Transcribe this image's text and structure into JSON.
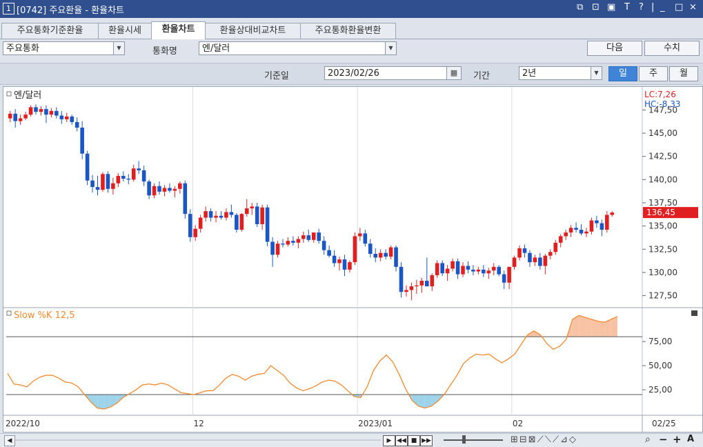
{
  "window": {
    "num": "1",
    "title": "[0742] 주요환율 - 환율차트",
    "controls": [
      "⧉",
      "⊡",
      "▣",
      "T",
      "?",
      "|",
      "_",
      "□",
      "×"
    ]
  },
  "tabs": [
    "주요통화기준환율",
    "환율시세",
    "환율차트",
    "환율상대비교차트",
    "주요통화환율변환"
  ],
  "filter": {
    "category": "주요통화",
    "currency_label": "통화명",
    "currency": "엔/달러",
    "next_label": "다음",
    "values_label": "수치"
  },
  "filter2": {
    "base_date_label": "기준일",
    "base_date": "2023/02/26",
    "period_label": "기간",
    "period": "2년",
    "periods": [
      "일",
      "주",
      "월"
    ]
  },
  "chart_data": [
    {
      "type": "candlestick",
      "title": "엔/달러",
      "lc": "LC:7,26",
      "hc": "HC:-8,33",
      "current_price": "136,45",
      "ylim": [
        126.5,
        148.5
      ],
      "yticks": [
        "147,50",
        "145,00",
        "142,50",
        "140,00",
        "137,50",
        "135,00",
        "132,50",
        "130,00",
        "127,50"
      ],
      "ytick_values": [
        147.5,
        145,
        142.5,
        140,
        137.5,
        135,
        132.5,
        130,
        127.5
      ],
      "colors": {
        "up": "#e02020",
        "down": "#1a56c4"
      },
      "candles": [
        [
          146.6,
          147.4,
          146.2,
          147.1
        ],
        [
          147.1,
          147.6,
          145.6,
          146.3
        ],
        [
          146.3,
          147.0,
          145.9,
          146.6
        ],
        [
          146.6,
          147.3,
          146.4,
          147.0
        ],
        [
          147.0,
          148.0,
          146.8,
          147.8
        ],
        [
          147.8,
          148.1,
          147.0,
          147.3
        ],
        [
          147.3,
          147.9,
          146.9,
          147.6
        ],
        [
          147.6,
          148.0,
          146.1,
          147.0
        ],
        [
          147.0,
          147.7,
          146.7,
          147.4
        ],
        [
          147.4,
          147.8,
          146.6,
          146.9
        ],
        [
          146.9,
          147.4,
          146.0,
          146.5
        ],
        [
          146.5,
          147.2,
          146.2,
          146.8
        ],
        [
          146.8,
          147.0,
          145.9,
          146.2
        ],
        [
          146.2,
          146.7,
          145.2,
          145.6
        ],
        [
          145.6,
          146.3,
          142.2,
          142.8
        ],
        [
          142.8,
          143.1,
          139.4,
          139.9
        ],
        [
          139.9,
          140.5,
          138.6,
          139.2
        ],
        [
          139.2,
          140.4,
          138.3,
          138.9
        ],
        [
          138.9,
          140.8,
          138.7,
          140.6
        ],
        [
          140.6,
          140.9,
          138.6,
          139.0
        ],
        [
          139.0,
          140.2,
          138.4,
          139.6
        ],
        [
          139.6,
          140.7,
          139.2,
          140.4
        ],
        [
          140.4,
          140.9,
          139.8,
          140.1
        ],
        [
          140.1,
          140.6,
          139.5,
          140.0
        ],
        [
          140.0,
          141.6,
          139.8,
          141.2
        ],
        [
          141.2,
          142.0,
          140.6,
          141.0
        ],
        [
          141.0,
          141.5,
          139.3,
          139.8
        ],
        [
          139.8,
          140.0,
          137.9,
          138.3
        ],
        [
          138.3,
          139.6,
          138.0,
          139.3
        ],
        [
          139.3,
          139.8,
          138.4,
          138.7
        ],
        [
          138.7,
          139.4,
          138.2,
          139.1
        ],
        [
          139.1,
          139.6,
          138.6,
          138.8
        ],
        [
          138.8,
          139.3,
          138.1,
          139.0
        ],
        [
          139.0,
          139.8,
          138.5,
          139.6
        ],
        [
          139.6,
          139.9,
          135.8,
          136.3
        ],
        [
          136.3,
          136.8,
          133.3,
          133.8
        ],
        [
          133.8,
          135.1,
          133.4,
          134.7
        ],
        [
          134.7,
          136.2,
          134.3,
          135.9
        ],
        [
          135.9,
          137.1,
          135.5,
          136.6
        ],
        [
          136.6,
          136.9,
          135.5,
          135.9
        ],
        [
          135.9,
          136.6,
          135.4,
          136.1
        ],
        [
          136.1,
          136.6,
          135.7,
          135.9
        ],
        [
          135.9,
          136.9,
          135.6,
          136.5
        ],
        [
          136.5,
          137.3,
          135.9,
          136.2
        ],
        [
          136.2,
          136.4,
          134.3,
          134.6
        ],
        [
          134.6,
          136.4,
          134.4,
          136.3
        ],
        [
          136.3,
          137.9,
          136.0,
          136.9
        ],
        [
          136.9,
          137.5,
          136.2,
          137.1
        ],
        [
          137.1,
          137.5,
          134.9,
          135.2
        ],
        [
          135.2,
          137.3,
          134.6,
          137.0
        ],
        [
          137.0,
          137.3,
          132.8,
          133.3
        ],
        [
          133.3,
          133.8,
          130.6,
          131.9
        ],
        [
          131.9,
          133.4,
          131.6,
          133.1
        ],
        [
          133.1,
          133.6,
          132.7,
          133.0
        ],
        [
          133.0,
          133.8,
          132.8,
          133.4
        ],
        [
          133.4,
          133.9,
          132.9,
          133.2
        ],
        [
          133.2,
          133.9,
          132.6,
          133.6
        ],
        [
          133.6,
          134.4,
          133.2,
          134.0
        ],
        [
          134.0,
          134.6,
          133.3,
          133.5
        ],
        [
          133.5,
          134.3,
          133.2,
          134.3
        ],
        [
          134.3,
          134.7,
          133.1,
          133.4
        ],
        [
          133.4,
          133.9,
          131.9,
          132.4
        ],
        [
          132.4,
          132.9,
          131.6,
          131.8
        ],
        [
          131.8,
          132.4,
          130.6,
          131.0
        ],
        [
          131.0,
          131.7,
          130.2,
          131.4
        ],
        [
          131.4,
          131.9,
          129.6,
          130.3
        ],
        [
          130.3,
          131.3,
          130.0,
          131.1
        ],
        [
          131.1,
          134.3,
          130.8,
          133.9
        ],
        [
          133.9,
          134.8,
          133.4,
          134.2
        ],
        [
          134.2,
          134.6,
          132.8,
          133.1
        ],
        [
          133.1,
          133.6,
          131.6,
          132.0
        ],
        [
          132.0,
          132.6,
          131.1,
          131.6
        ],
        [
          131.6,
          132.5,
          131.2,
          132.1
        ],
        [
          132.1,
          132.5,
          131.4,
          131.7
        ],
        [
          131.7,
          132.9,
          131.4,
          132.7
        ],
        [
          132.7,
          132.9,
          130.1,
          130.6
        ],
        [
          130.6,
          131.1,
          127.3,
          127.9
        ],
        [
          127.9,
          128.6,
          127.4,
          128.1
        ],
        [
          128.1,
          128.9,
          127.0,
          128.5
        ],
        [
          128.5,
          129.2,
          127.7,
          128.6
        ],
        [
          128.6,
          129.4,
          127.8,
          129.1
        ],
        [
          129.1,
          131.6,
          128.5,
          128.5
        ],
        [
          128.5,
          129.9,
          128.0,
          129.7
        ],
        [
          129.7,
          131.3,
          129.4,
          131.0
        ],
        [
          131.0,
          131.3,
          129.6,
          129.9
        ],
        [
          129.9,
          130.8,
          129.1,
          130.4
        ],
        [
          130.4,
          131.5,
          130.1,
          131.2
        ],
        [
          131.2,
          131.5,
          129.3,
          129.8
        ],
        [
          129.8,
          131.1,
          129.5,
          130.7
        ],
        [
          130.7,
          131.2,
          129.9,
          130.3
        ],
        [
          130.3,
          130.8,
          129.7,
          130.1
        ],
        [
          130.1,
          130.6,
          129.8,
          130.3
        ],
        [
          130.3,
          130.8,
          129.5,
          129.9
        ],
        [
          129.9,
          130.5,
          129.3,
          130.2
        ],
        [
          130.2,
          131.0,
          129.7,
          130.6
        ],
        [
          130.6,
          130.8,
          129.6,
          129.8
        ],
        [
          129.8,
          130.2,
          128.2,
          128.9
        ],
        [
          128.9,
          130.1,
          128.2,
          130.6
        ],
        [
          130.6,
          131.8,
          130.3,
          131.6
        ],
        [
          131.6,
          132.9,
          131.3,
          132.6
        ],
        [
          132.6,
          133.0,
          131.6,
          132.1
        ],
        [
          132.1,
          132.4,
          130.6,
          131.1
        ],
        [
          131.1,
          131.9,
          130.7,
          131.6
        ],
        [
          131.6,
          132.1,
          130.3,
          130.7
        ],
        [
          130.7,
          132.0,
          129.8,
          131.8
        ],
        [
          131.8,
          132.5,
          131.4,
          132.2
        ],
        [
          132.2,
          133.5,
          131.9,
          133.2
        ],
        [
          133.2,
          134.1,
          132.7,
          133.9
        ],
        [
          133.9,
          134.6,
          133.5,
          134.3
        ],
        [
          134.3,
          135.1,
          133.8,
          134.8
        ],
        [
          134.8,
          135.4,
          134.3,
          134.6
        ],
        [
          134.6,
          135.2,
          134.0,
          134.2
        ],
        [
          134.2,
          134.8,
          133.8,
          134.4
        ],
        [
          134.4,
          135.9,
          134.1,
          135.6
        ],
        [
          135.6,
          136.1,
          134.8,
          135.3
        ],
        [
          135.3,
          135.7,
          133.9,
          134.6
        ],
        [
          134.6,
          136.6,
          134.3,
          136.2
        ],
        [
          136.2,
          136.6,
          136.0,
          136.45
        ]
      ]
    },
    {
      "type": "line",
      "title": "Slow %K 12,5",
      "ylim": [
        0,
        108
      ],
      "yticks": [
        "75,00",
        "50,00",
        "25,00"
      ],
      "ytick_values": [
        75,
        50,
        25
      ],
      "overbought": 80,
      "oversold": 20,
      "colors": {
        "line": "#f28a2e",
        "overbought": "#f8c3a4",
        "oversold": "#9fd3ea"
      },
      "values": [
        42,
        31,
        30,
        28,
        34,
        38,
        40,
        40,
        37,
        33,
        32,
        28,
        20,
        12,
        6,
        5,
        7,
        11,
        17,
        21,
        25,
        30,
        31,
        30,
        32,
        30,
        26,
        22,
        21,
        20,
        22,
        24,
        24,
        30,
        37,
        41,
        39,
        35,
        39,
        41,
        42,
        50,
        45,
        40,
        32,
        27,
        24,
        26,
        29,
        33,
        35,
        34,
        30,
        24,
        18,
        17,
        28,
        45,
        55,
        61,
        54,
        41,
        26,
        14,
        8,
        6,
        8,
        13,
        20,
        30,
        40,
        52,
        58,
        62,
        61,
        62,
        57,
        53,
        57,
        62,
        72,
        82,
        86,
        82,
        73,
        67,
        70,
        77,
        98,
        102,
        100,
        98,
        96,
        95,
        98,
        101
      ]
    }
  ],
  "xaxis": {
    "labels": [
      "2022/10",
      "12",
      "2023/01",
      "02"
    ],
    "current": "02/25"
  }
}
